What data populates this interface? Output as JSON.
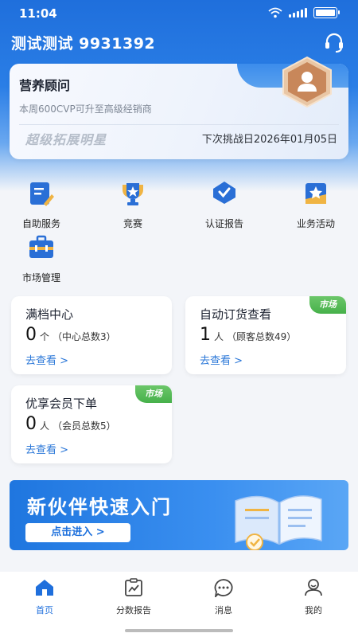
{
  "status_bar": {
    "time": "11:04",
    "battery_level": 1.0
  },
  "header": {
    "user_title": "测试测试 9931392"
  },
  "consultant_card": {
    "title": "营养顾问",
    "subtitle": "本周600CVP可升至高级经销商",
    "brand_text": "超级拓展明星",
    "next_challenge": "下次挑战日2026年01月05日"
  },
  "quick_actions": [
    {
      "label": "自助服务",
      "icon": "self-service-icon"
    },
    {
      "label": "竞赛",
      "icon": "trophy-icon"
    },
    {
      "label": "认证报告",
      "icon": "certificate-icon"
    },
    {
      "label": "业务活动",
      "icon": "star-flag-icon"
    },
    {
      "label": "市场管理",
      "icon": "toolbox-icon"
    }
  ],
  "stat_cards": [
    {
      "title": "满档中心",
      "number": "0",
      "unit": "个",
      "note": "（中心总数3）",
      "link": "去查看 >",
      "tag": ""
    },
    {
      "title": "自动订货查看",
      "number": "1",
      "unit": "人",
      "note": "（顾客总数49）",
      "link": "去查看 >",
      "tag": "市场"
    },
    {
      "title": "优享会员下单",
      "number": "0",
      "unit": "人",
      "note": "（会员总数5）",
      "link": "去查看 >",
      "tag": "市场"
    }
  ],
  "banner": {
    "title": "新伙伴快速入门",
    "button": "点击进入 >"
  },
  "bottom_nav": [
    {
      "label": "首页",
      "icon": "home-icon",
      "active": true
    },
    {
      "label": "分数报告",
      "icon": "report-icon",
      "active": false
    },
    {
      "label": "消息",
      "icon": "message-icon",
      "active": false
    },
    {
      "label": "我的",
      "icon": "profile-icon",
      "active": false
    }
  ],
  "colors": {
    "primary": "#1f6fdc",
    "market_tag": "#46b14a",
    "link": "#2c78d8",
    "badge": "#c8875a"
  }
}
